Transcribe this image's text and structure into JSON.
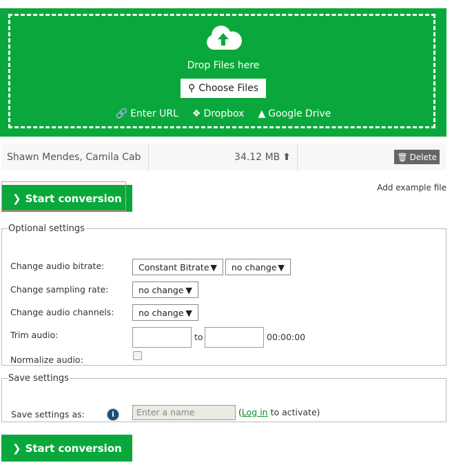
{
  "upload": {
    "drop_text": "Drop Files here",
    "choose_label": "Choose Files",
    "links": [
      "Enter URL",
      "Dropbox",
      "Google Drive"
    ]
  },
  "file": {
    "name": "Shawn Mendes, Camila Cab",
    "size": "34.12 MB",
    "delete_label": "Delete"
  },
  "start_label": "Start conversion",
  "add_example": "Add example file",
  "optional": {
    "legend": "Optional settings",
    "bitrate_label": "Change audio bitrate:",
    "bitrate_mode": "Constant Bitrate",
    "bitrate_value": "no change",
    "sampling_label": "Change sampling rate:",
    "sampling_value": "no change",
    "channels_label": "Change audio channels:",
    "channels_value": "no change",
    "trim_label": "Trim audio:",
    "trim_to": "to",
    "trim_time": "00:00:00",
    "normalize_label": "Normalize audio:"
  },
  "save": {
    "legend": "Save settings",
    "label": "Save settings as:",
    "placeholder": "Enter a name",
    "paren_open": "(",
    "login": "Log in",
    "activate": " to activate)"
  },
  "colors": {
    "brand": "#0aa83c"
  }
}
